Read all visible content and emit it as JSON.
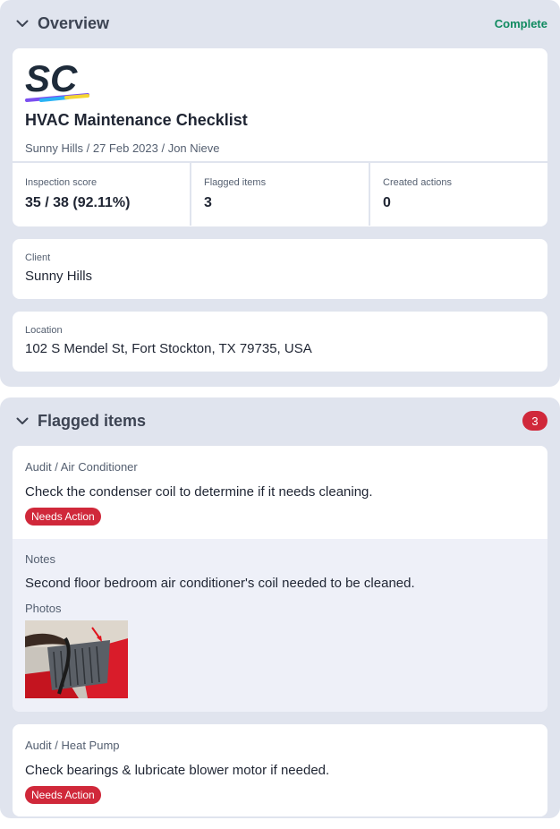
{
  "overview": {
    "title": "Overview",
    "status": "Complete",
    "logo": "SC",
    "doc_title": "HVAC Maintenance Checklist",
    "doc_subtitle": "Sunny Hills / 27 Feb 2023 / Jon Nieve",
    "stats": [
      {
        "label": "Inspection score",
        "value": "35 / 38 (92.11%)"
      },
      {
        "label": "Flagged items",
        "value": "3"
      },
      {
        "label": "Created actions",
        "value": "0"
      }
    ],
    "client": {
      "label": "Client",
      "value": "Sunny Hills"
    },
    "location": {
      "label": "Location",
      "value": "102 S Mendel St, Fort Stockton, TX 79735, USA"
    }
  },
  "flagged": {
    "title": "Flagged items",
    "count": "3",
    "items": [
      {
        "path": "Audit / Air Conditioner",
        "question": "Check the condenser coil to determine if it needs cleaning.",
        "badge": "Needs Action",
        "notes_label": "Notes",
        "notes": "Second floor bedroom air conditioner's coil needed to be cleaned.",
        "photos_label": "Photos"
      },
      {
        "path": "Audit / Heat Pump",
        "question": "Check bearings & lubricate blower motor if needed.",
        "badge": "Needs Action"
      }
    ]
  },
  "colors": {
    "section_bg": "#e0e4ee",
    "complete": "#0f8a5f",
    "flag_red": "#d0283a",
    "notes_bg": "#eef0f8"
  },
  "icons": [
    "chevron-down-icon",
    "sc-logo",
    "photo-thumbnail"
  ]
}
